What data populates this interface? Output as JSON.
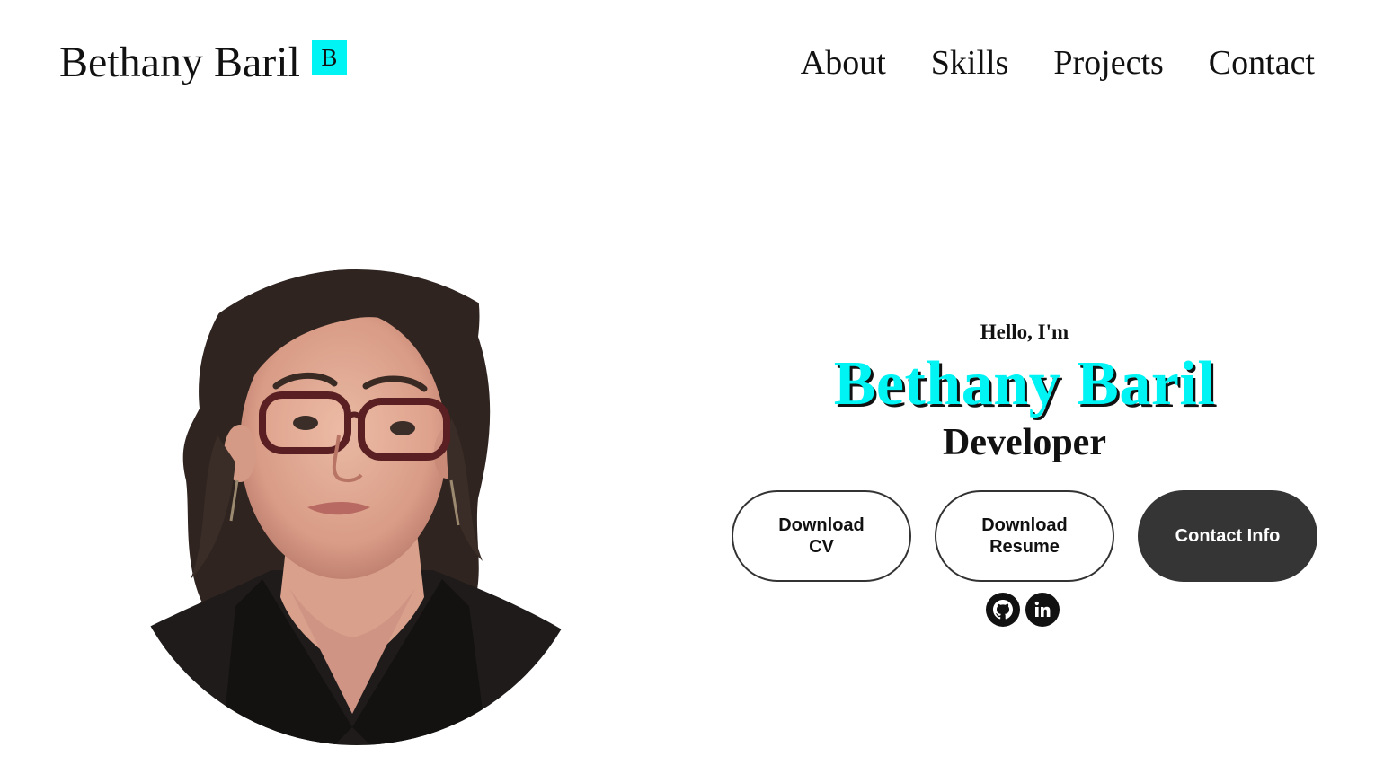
{
  "header": {
    "brand_name": "Bethany Baril",
    "brand_logo_letter": "B",
    "brand_logo_color": "#00f4f4",
    "nav": [
      {
        "label": "About"
      },
      {
        "label": "Skills"
      },
      {
        "label": "Projects"
      },
      {
        "label": "Contact"
      }
    ]
  },
  "profile": {
    "photo_icon": "profile-portrait-photo"
  },
  "intro": {
    "greeting": "Hello, I'm",
    "name": "Bethany Baril",
    "role": "Developer",
    "name_color": "#00f4f4"
  },
  "buttons": {
    "download_cv": "Download CV",
    "download_resume": "Download Resume",
    "contact_info": "Contact Info"
  },
  "socials": [
    {
      "icon": "github-icon"
    },
    {
      "icon": "linkedin-icon"
    }
  ],
  "colors": {
    "accent": "#00f4f4",
    "dark_button": "#353535",
    "text": "#111111"
  }
}
